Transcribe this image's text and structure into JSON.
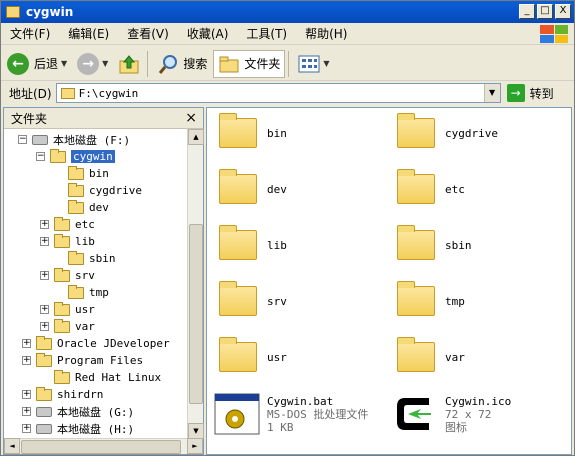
{
  "window": {
    "title": "cygwin",
    "min": "_",
    "max": "□",
    "close": "X"
  },
  "menu": [
    "文件(F)",
    "编辑(E)",
    "查看(V)",
    "收藏(A)",
    "工具(T)",
    "帮助(H)"
  ],
  "toolbar": {
    "back": "后退",
    "search": "搜索",
    "folders": "文件夹"
  },
  "address": {
    "label": "地址(D)",
    "value": "F:\\cygwin",
    "go": "转到"
  },
  "folder_pane": {
    "title": "文件夹",
    "close": "×",
    "tree": [
      {
        "label": "本地磁盘 (F:)",
        "box": "−",
        "icon": "drive"
      },
      {
        "label": "cygwin",
        "box": "−",
        "icon": "folder",
        "selected": true
      },
      {
        "label": "bin",
        "box": "",
        "icon": "folder"
      },
      {
        "label": "cygdrive",
        "box": "",
        "icon": "folder"
      },
      {
        "label": "dev",
        "box": "",
        "icon": "folder"
      },
      {
        "label": "etc",
        "box": "+",
        "icon": "folder"
      },
      {
        "label": "lib",
        "box": "+",
        "icon": "folder"
      },
      {
        "label": "sbin",
        "box": "",
        "icon": "folder"
      },
      {
        "label": "srv",
        "box": "+",
        "icon": "folder"
      },
      {
        "label": "tmp",
        "box": "",
        "icon": "folder"
      },
      {
        "label": "usr",
        "box": "+",
        "icon": "folder"
      },
      {
        "label": "var",
        "box": "+",
        "icon": "folder"
      },
      {
        "label": "Oracle JDeveloper",
        "box": "+",
        "icon": "folder"
      },
      {
        "label": "Program Files",
        "box": "+",
        "icon": "folder"
      },
      {
        "label": "Red Hat Linux",
        "box": "",
        "icon": "folder"
      },
      {
        "label": "shirdrn",
        "box": "+",
        "icon": "folder"
      },
      {
        "label": "本地磁盘 (G:)",
        "box": "+",
        "icon": "drive"
      },
      {
        "label": "本地磁盘 (H:)",
        "box": "+",
        "icon": "drive"
      }
    ]
  },
  "contents": {
    "folders": [
      "bin",
      "cygdrive",
      "dev",
      "etc",
      "lib",
      "sbin",
      "srv",
      "tmp",
      "usr",
      "var"
    ],
    "files": [
      {
        "name": "Cygwin.bat",
        "line2": "MS-DOS 批处理文件",
        "line3": "1 KB"
      },
      {
        "name": "Cygwin.ico",
        "line2": "72 x 72",
        "line3": "图标"
      }
    ]
  },
  "colors": {
    "titlebar": "#0a5fd9",
    "selection": "#316ac5",
    "folder": "#f6dc7c"
  }
}
